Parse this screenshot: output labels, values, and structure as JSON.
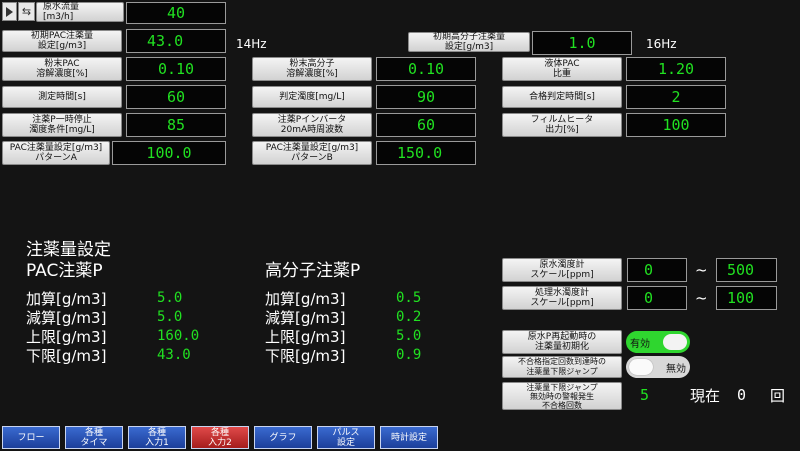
{
  "top": {
    "raw_flow_label": "原水流量\n[m3/h]",
    "raw_flow_value": "40",
    "initial_pac_label": "初期PAC注薬量\n設定[g/m3]",
    "initial_pac_value": "43.0",
    "freq1": "14Hz",
    "initial_polymer_label": "初期高分子注薬量\n設定[g/m3]",
    "initial_polymer_value": "1.0",
    "freq2": "16Hz"
  },
  "params": {
    "powder_pac_label": "粉末PAC\n溶解濃度[%]",
    "powder_pac_value": "0.10",
    "powder_polymer_label": "粉末高分子\n溶解濃度[%]",
    "powder_polymer_value": "0.10",
    "liquid_pac_label": "液体PAC\n比重",
    "liquid_pac_value": "1.20",
    "measure_time_label": "測定時間[s]",
    "measure_time_value": "60",
    "judge_turbidity_label": "判定濁度[mg/L]",
    "judge_turbidity_value": "90",
    "pass_time_label": "合格判定時間[s]",
    "pass_time_value": "2",
    "pump_stop_label": "注薬P一時停止\n濁度条件[mg/L]",
    "pump_stop_value": "85",
    "inverter_label": "注薬Pインバータ\n20mA時周波数",
    "inverter_value": "60",
    "film_heater_label": "フィルムヒータ\n出力[%]",
    "film_heater_value": "100",
    "pattern_a_label": "PAC注薬量設定[g/m3]\nパターンA",
    "pattern_a_value": "100.0",
    "pattern_b_label": "PAC注薬量設定[g/m3]\nパターンB",
    "pattern_b_value": "150.0"
  },
  "dosing": {
    "title": "注薬量設定",
    "pac_title": "PAC注薬P",
    "polymer_title": "高分子注薬P",
    "add_label": "加算[g/m3]",
    "sub_label": "減算[g/m3]",
    "upper_label": "上限[g/m3]",
    "lower_label": "下限[g/m3]",
    "pac": {
      "add": "5.0",
      "sub": "5.0",
      "upper": "160.0",
      "lower": "43.0"
    },
    "polymer": {
      "add": "0.5",
      "sub": "0.2",
      "upper": "5.0",
      "lower": "0.9"
    }
  },
  "scales": {
    "raw_label": "原水濁度計\nスケール[ppm]",
    "raw_min": "0",
    "raw_max": "500",
    "treated_label": "処理水濁度計\nスケール[ppm]",
    "treated_min": "0",
    "treated_max": "100",
    "tilde": "~"
  },
  "toggles": {
    "restart_init_label": "原水P再起動時の\n注薬量初期化",
    "restart_init_state": "有効",
    "jump_label": "不合格指定回数到達時の\n注薬量下限ジャンプ",
    "jump_state": "無効",
    "jump_count_label": "注薬量下限ジャンプ\n無効時の警報発生\n不合格回数",
    "jump_count_value": "5",
    "current_label": "現在",
    "current_value": "0",
    "times_label": "回"
  },
  "nav": [
    {
      "label": "フロー"
    },
    {
      "label": "各種\nタイマ"
    },
    {
      "label": "各種\n入力1"
    },
    {
      "label": "各種\n入力2"
    },
    {
      "label": "グラフ"
    },
    {
      "label": "パルス\n設定"
    },
    {
      "label": "時計設定"
    }
  ],
  "colors": {
    "value_green": "#21e021",
    "nav_blue": "#2a55b8",
    "nav_active_red": "#c42a2a",
    "toggle_on": "#2fd62f"
  },
  "icons": [
    "play-icon",
    "swap-arrows-icon"
  ]
}
